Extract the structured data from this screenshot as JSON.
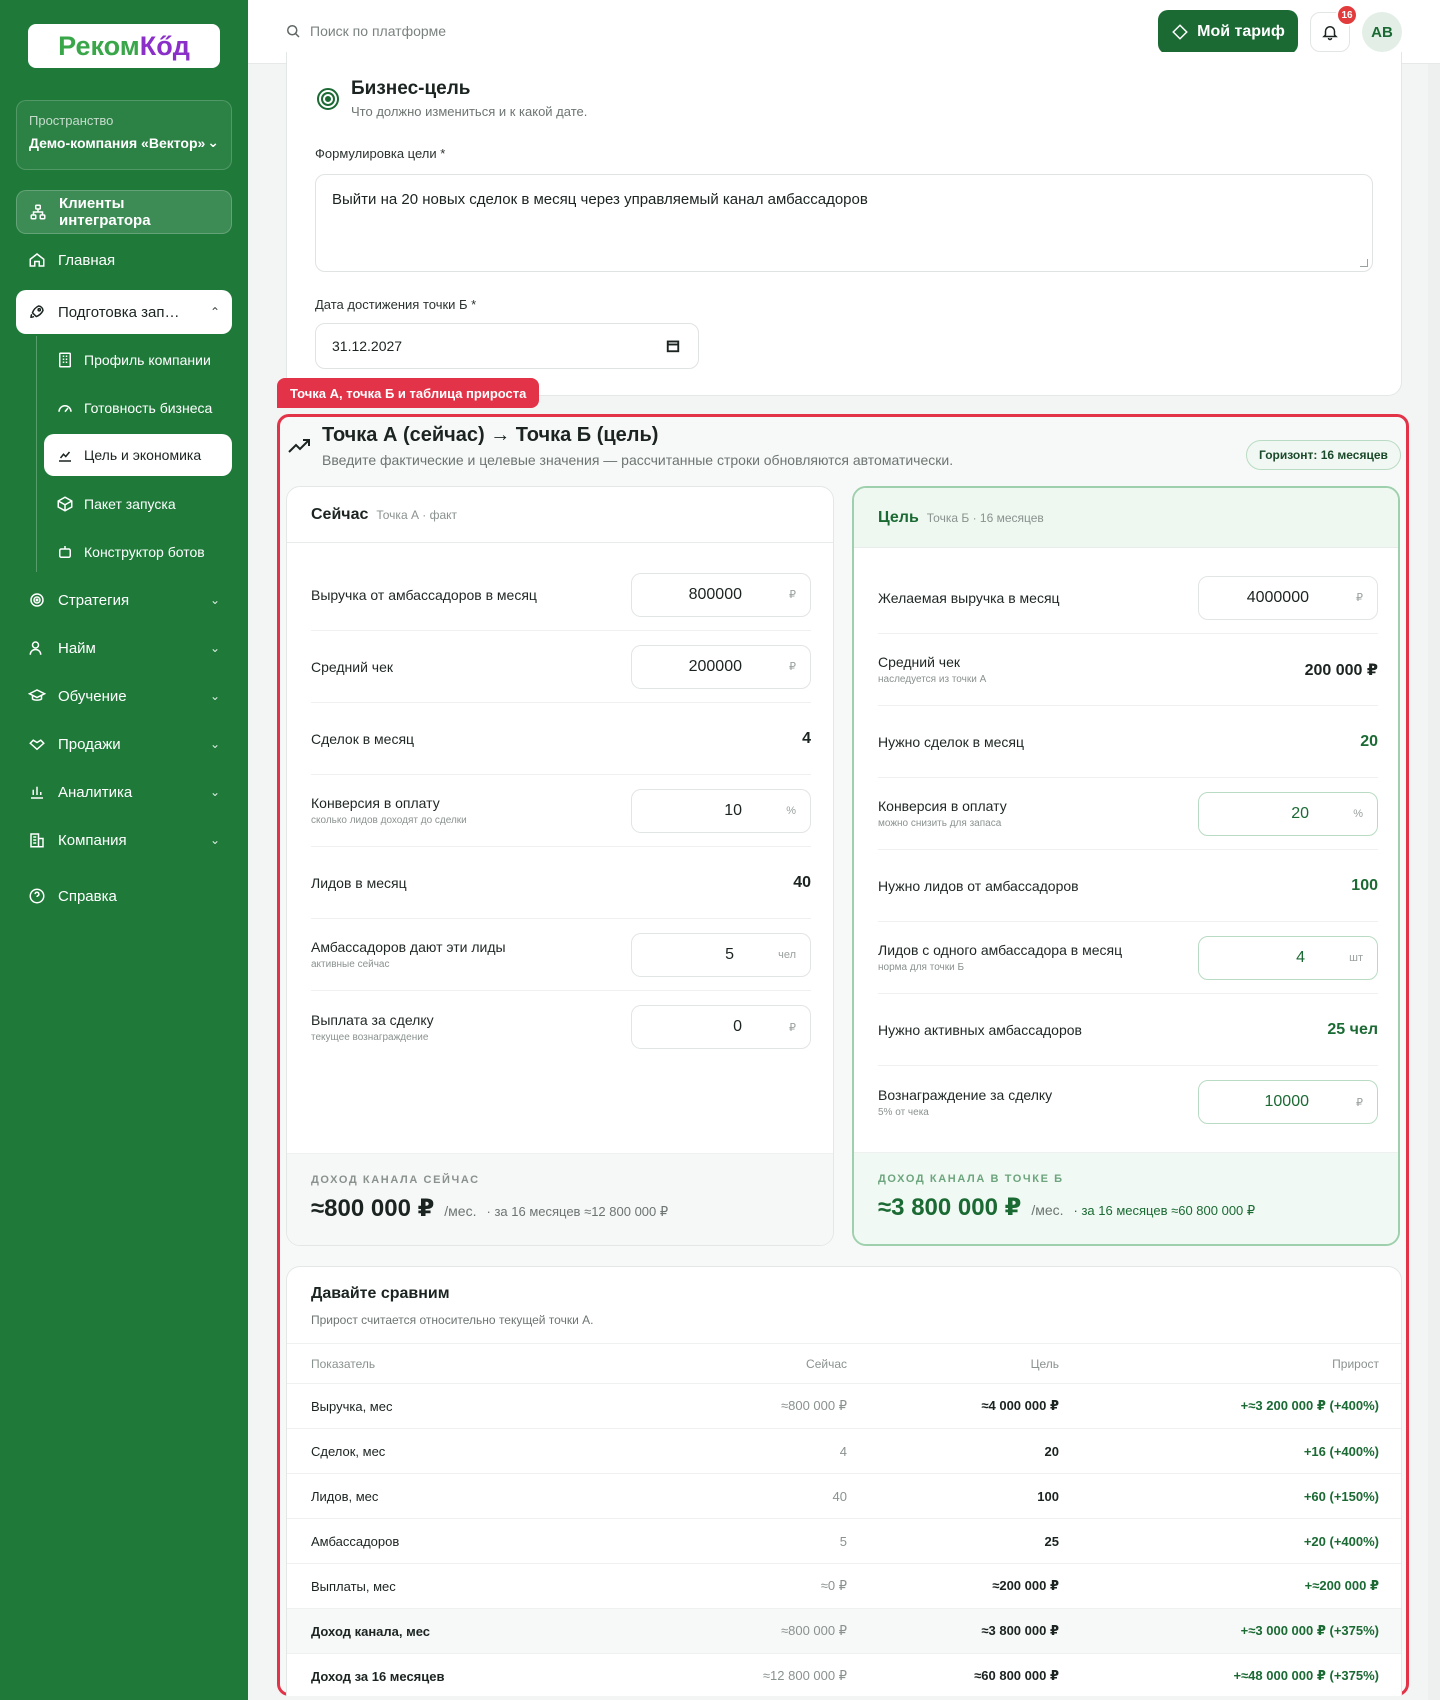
{
  "logo": {
    "part1": "Реком",
    "part2": "Кőд"
  },
  "sidebar": {
    "space_label": "Пространство",
    "space_value": "Демо-компания «Вектор»",
    "clients": "Клиенты интегратора",
    "home": "Главная",
    "prep": "Подготовка зап…",
    "sub": [
      "Профиль компании",
      "Готовность бизнеса",
      "Цель и экономика",
      "Пакет запуска",
      "Конструктор ботов"
    ],
    "groups": [
      "Стратегия",
      "Найм",
      "Обучение",
      "Продажи",
      "Аналитика",
      "Компания"
    ],
    "help": "Справка"
  },
  "header": {
    "search_placeholder": "Поиск по платформе",
    "tariff": "Мой тариф",
    "notifications": "16",
    "avatar": "AB"
  },
  "goal": {
    "title": "Бизнес-цель",
    "subtitle": "Что должно измениться и к какой дате.",
    "formulation_label": "Формулировка цели *",
    "formulation_value": "Выйти на 20 новых сделок в месяц через управляемый канал амбассадоров",
    "date_label": "Дата достижения точки Б *",
    "date_value": "31.12.2027"
  },
  "annotation": "Точка А, точка Б и таблица прироста",
  "ab": {
    "title": "Точка А (сейчас) → Точка Б (цель)",
    "subtitle": "Введите фактические и целевые значения — рассчитанные строки обновляются автоматически.",
    "horizon": "Горизонт: 16 месяцев"
  },
  "now": {
    "title": "Сейчас",
    "tag": "Точка А · факт",
    "rows": [
      {
        "label": "Выручка от амбассадоров в месяц",
        "hint": "",
        "value": "800000",
        "unit": "₽"
      },
      {
        "label": "Средний чек",
        "hint": "",
        "value": "200000",
        "unit": "₽"
      },
      {
        "label": "Сделок в месяц",
        "hint": "",
        "value": "4"
      },
      {
        "label": "Конверсия в оплату",
        "hint": "сколько лидов доходят до сделки",
        "value": "10",
        "unit": "%"
      },
      {
        "label": "Лидов в месяц",
        "hint": "",
        "value": "40"
      },
      {
        "label": "Амбассадоров дают эти лиды",
        "hint": "активные сейчас",
        "value": "5",
        "unit": "чел"
      },
      {
        "label": "Выплата за сделку",
        "hint": "текущее вознаграждение",
        "value": "0",
        "unit": "₽"
      }
    ],
    "foot_label": "ДОХОД КАНАЛА СЕЙЧАС",
    "foot_value": "≈800 000 ₽",
    "foot_per": "/мес.",
    "foot_total": "· за 16 месяцев ≈12 800 000 ₽"
  },
  "target": {
    "title": "Цель",
    "tag": "Точка Б · 16 месяцев",
    "rows": [
      {
        "label": "Желаемая выручка в месяц",
        "hint": "",
        "value": "4000000",
        "unit": "₽"
      },
      {
        "label": "Средний чек",
        "hint": "наследуется из точки А",
        "value": "200 000 ₽"
      },
      {
        "label": "Нужно сделок в месяц",
        "hint": "",
        "value": "20"
      },
      {
        "label": "Конверсия в оплату",
        "hint": "можно снизить для запаса",
        "value": "20",
        "unit": "%"
      },
      {
        "label": "Нужно лидов от амбассадоров",
        "hint": "",
        "value": "100"
      },
      {
        "label": "Лидов с одного амбассадора в месяц",
        "hint": "норма для точки Б",
        "value": "4",
        "unit": "шт"
      },
      {
        "label": "Нужно активных амбассадоров",
        "hint": "",
        "value": "25 чел"
      },
      {
        "label": "Вознаграждение за сделку",
        "hint": "5% от чека",
        "value": "10000",
        "unit": "₽"
      }
    ],
    "foot_label": "ДОХОД КАНАЛА В ТОЧКЕ Б",
    "foot_value": "≈3 800 000 ₽",
    "foot_per": "/мес.",
    "foot_total": "· за 16 месяцев ≈60 800 000 ₽"
  },
  "compare": {
    "title": "Давайте сравним",
    "subtitle": "Прирост считается относительно текущей точки А.",
    "headers": [
      "Показатель",
      "Сейчас",
      "Цель",
      "Прирост"
    ],
    "rows": [
      [
        "Выручка, мес",
        "≈800 000 ₽",
        "≈4 000 000 ₽",
        "+≈3 200 000 ₽ (+400%)"
      ],
      [
        "Сделок, мес",
        "4",
        "20",
        "+16 (+400%)"
      ],
      [
        "Лидов, мес",
        "40",
        "100",
        "+60 (+150%)"
      ],
      [
        "Амбассадоров",
        "5",
        "25",
        "+20 (+400%)"
      ],
      [
        "Выплаты, мес",
        "≈0 ₽",
        "≈200 000 ₽",
        "+≈200 000 ₽"
      ],
      [
        "Доход канала, мес",
        "≈800 000 ₽",
        "≈3 800 000 ₽",
        "+≈3 000 000 ₽ (+375%)"
      ],
      [
        "Доход за 16 месяцев",
        "≈12 800 000 ₽",
        "≈60 800 000 ₽",
        "+≈48 000 000 ₽ (+375%)"
      ]
    ]
  },
  "colors": {
    "sidebar": "#1f7a3a",
    "accent": "#1b6a34",
    "annotation": "#e23348"
  }
}
